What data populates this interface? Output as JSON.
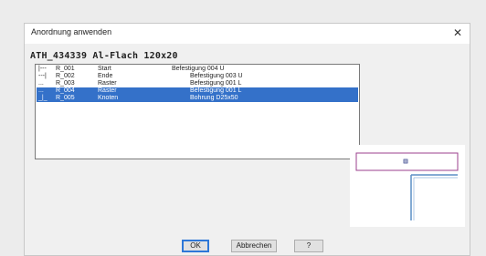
{
  "dialog": {
    "title": "Anordnung anwenden",
    "heading": "ATH_434339 Al-Flach 120x20",
    "close_glyph": "✕"
  },
  "list": {
    "rows": [
      {
        "prefix": "|---",
        "id": "R_001",
        "type": "Start",
        "detail": "Befestigung 004 U",
        "indent": 0,
        "selected": false
      },
      {
        "prefix": "---|",
        "id": "R_002",
        "type": "Ende",
        "detail": "Befestigung 003 U",
        "indent": 1,
        "selected": false
      },
      {
        "prefix": "...",
        "id": "R_003",
        "type": "Raster",
        "detail": "Befestigung 001 L",
        "indent": 1,
        "selected": false
      },
      {
        "prefix": "...",
        "id": "R_004",
        "type": "Raster",
        "detail": "Befestigung 001 L",
        "indent": 1,
        "selected": true
      },
      {
        "prefix": "_|_",
        "id": "R_005",
        "type": "Knoten",
        "detail": "Bohrung D25x50",
        "indent": 1,
        "selected": true
      }
    ]
  },
  "buttons": {
    "ok": "OK",
    "cancel": "Abbrechen",
    "help": "?"
  },
  "colors": {
    "selection": "#3471c9",
    "profile_outline": "#9b3f8c",
    "profile_beam": "#5b8fc6"
  }
}
